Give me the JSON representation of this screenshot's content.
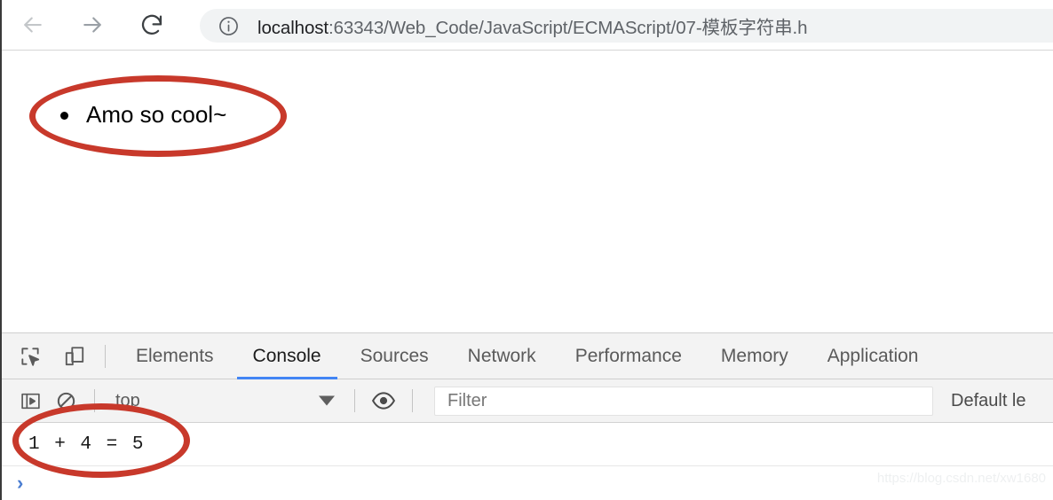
{
  "browser": {
    "nav": {
      "back_label": "Back",
      "back_icon": "arrow-left-icon",
      "forward_label": "Forward",
      "forward_icon": "arrow-right-icon",
      "reload_label": "Reload this page",
      "reload_icon": "reload-icon"
    },
    "omnibox": {
      "info_icon": "site-information-icon",
      "url_host": "localhost",
      "url_rest": ":63343/Web_Code/JavaScript/ECMAScript/07-模板字符串.h",
      "url_full": "localhost:63343/Web_Code/JavaScript/ECMAScript/07-模板字符串.h"
    }
  },
  "page": {
    "list_items": [
      {
        "text": "Amo so cool~"
      }
    ]
  },
  "devtools": {
    "toolbar_icons": [
      {
        "name": "inspect-element-icon",
        "title": "Inspect element"
      },
      {
        "name": "device-toolbar-icon",
        "title": "Toggle device toolbar"
      }
    ],
    "tabs": [
      {
        "label": "Elements",
        "active": false
      },
      {
        "label": "Console",
        "active": true
      },
      {
        "label": "Sources",
        "active": false
      },
      {
        "label": "Network",
        "active": false
      },
      {
        "label": "Performance",
        "active": false
      },
      {
        "label": "Memory",
        "active": false
      },
      {
        "label": "Application",
        "active": false
      }
    ],
    "console_toolbar": {
      "sidebar_icon": "console-sidebar-icon",
      "clear_icon": "clear-console-icon",
      "context": "top",
      "context_caret_icon": "chevron-down-icon",
      "eye_icon": "create-live-expression-icon",
      "filter_placeholder": "Filter",
      "filter_value": "",
      "levels_label": "Default le"
    },
    "console_messages": [
      {
        "text": "1 + 4 = 5"
      }
    ],
    "prompt_caret": "›"
  },
  "annotations": {
    "highlight_color": "#c8392b",
    "ellipses": [
      {
        "name": "annotation-ellipse-page-output"
      },
      {
        "name": "annotation-ellipse-console-output"
      }
    ]
  },
  "watermark": {
    "text": "https://blog.csdn.net/xw1680"
  }
}
